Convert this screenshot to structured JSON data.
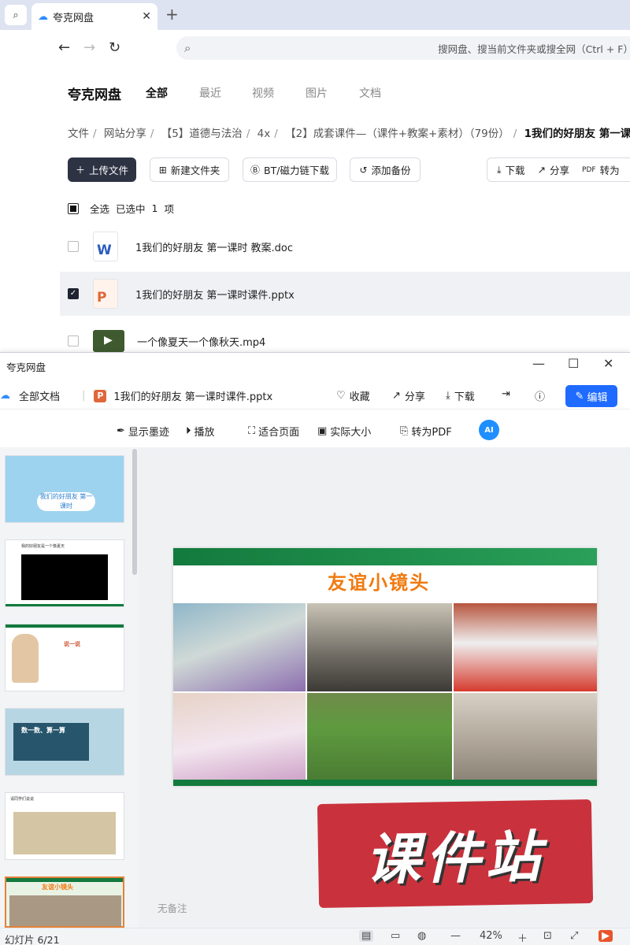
{
  "browser": {
    "tab_title": "夸克网盘",
    "address_placeholder": "搜网盘、搜当前文件夹或搜全网（Ctrl + F）"
  },
  "app": {
    "brand": "夸克网盘",
    "nav_tabs": [
      "全部",
      "最近",
      "视频",
      "图片",
      "文档"
    ],
    "breadcrumb": [
      "文件",
      "网站分享",
      "【5】道德与法治",
      "4x",
      "【2】成套课件—（课件+教案+素材）（79份）",
      "1我们的好朋友 第一课"
    ],
    "toolbar": {
      "upload": "上传文件",
      "new_folder": "新建文件夹",
      "bt": "BT/磁力链下载",
      "backup": "添加备份",
      "download": "下载",
      "share": "分享",
      "convert": "转为"
    },
    "selection": {
      "select_all": "全选",
      "selected": "已选中",
      "count": "1",
      "unit": "项"
    },
    "files": [
      {
        "name": "1我们的好朋友  第一课时 教案.doc",
        "type": "W"
      },
      {
        "name": "1我们的好朋友  第一课时课件.pptx",
        "type": "P"
      },
      {
        "name": "一个像夏天一个像秋天.mp4",
        "type": "video"
      }
    ]
  },
  "viewer": {
    "window_title": "夸克网盘",
    "all_docs": "全部文档",
    "file_name": "1我们的好朋友 第一课时课件.pptx",
    "actions": {
      "favorite": "收藏",
      "share": "分享",
      "download": "下载",
      "edit": "编辑"
    },
    "tools": {
      "ink": "显示墨迹",
      "play": "播放",
      "fit": "适合页面",
      "actual": "实际大小",
      "pdf": "转为PDF",
      "ai": "AI"
    },
    "slide_title": "友谊小镜头",
    "thumbs": [
      "我们的好朋友 第一课时",
      "我的好朋友是一个像夏天",
      "说一说",
      "数一数、算一算",
      "请同学们说说"
    ],
    "notes": "无备注",
    "stamp": "课件站",
    "status": {
      "page": "幻灯片 6/21",
      "zoom": "42%"
    }
  }
}
